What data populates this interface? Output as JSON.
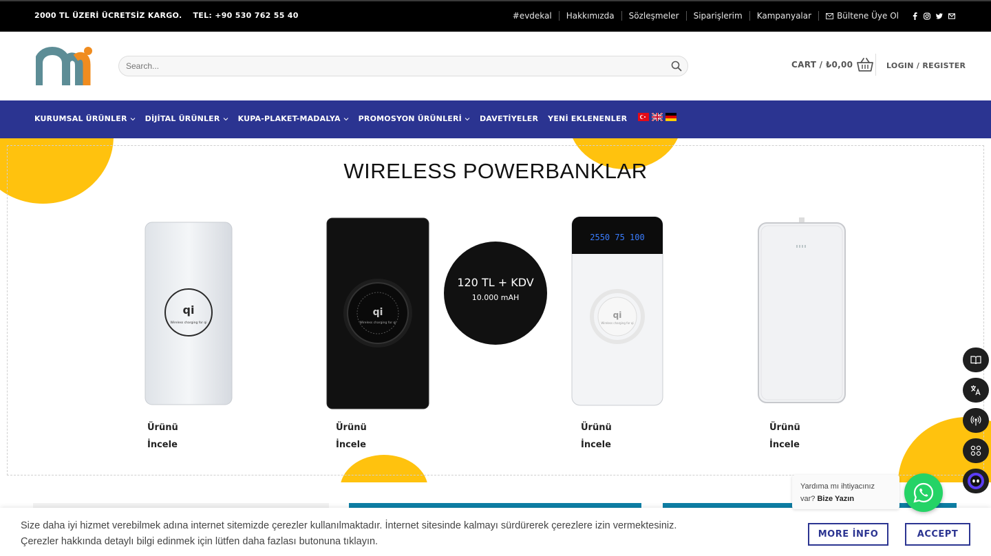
{
  "topbar": {
    "shipping": "2000 TL ÜZERİ ÜCRETSİZ KARGO.",
    "phone": "TEL: +90 530 762 55 40",
    "links": [
      "#evdekal",
      "Hakkımızda",
      "Sözleşmeler",
      "Siparişlerim",
      "Kampanyalar"
    ],
    "newsletter": "Bültene Üye Ol"
  },
  "header": {
    "search_placeholder": "Search...",
    "cart_label": "CART / ₺0,00",
    "login_label": "LOGIN / REGISTER"
  },
  "nav": {
    "items": [
      "KURUMSAL ÜRÜNLER",
      "DİJİTAL ÜRÜNLER",
      "KUPA-PLAKET-MADALYA",
      "PROMOSYON ÜRÜNLERİ",
      "DAVETİYELER",
      "YENİ EKLENENLER"
    ]
  },
  "section": {
    "title": "WIRELESS POWERBANKLAR",
    "price_main": "120 TL + KDV",
    "price_sub": "10.000 mAH",
    "product_label_1": "Ürünü",
    "product_label_2": "İncele",
    "device_screen_text": "2550 75 100",
    "qi_caption": "Wireless charging for qi"
  },
  "cookie": {
    "line1": "Size daha iyi hizmet verebilmek adına internet sitemizde çerezler kullanılmaktadır. İnternet sitesinde kalmayı sürdürerek çerezlere izin vermektesiniz.",
    "line2": "Çerezler hakkında detaylı bilgi edinmek için lütfen daha fazlası butonuna tıklayın.",
    "more_info": "MORE İNFO",
    "accept": "ACCEPT"
  },
  "chat": {
    "prompt": "Yardıma mı ihtiyacınız var?",
    "cta": "Bize Yazın"
  },
  "colors": {
    "nav_bg": "#2b3491",
    "accent_yellow": "#ffc20e",
    "whatsapp": "#25d366"
  }
}
